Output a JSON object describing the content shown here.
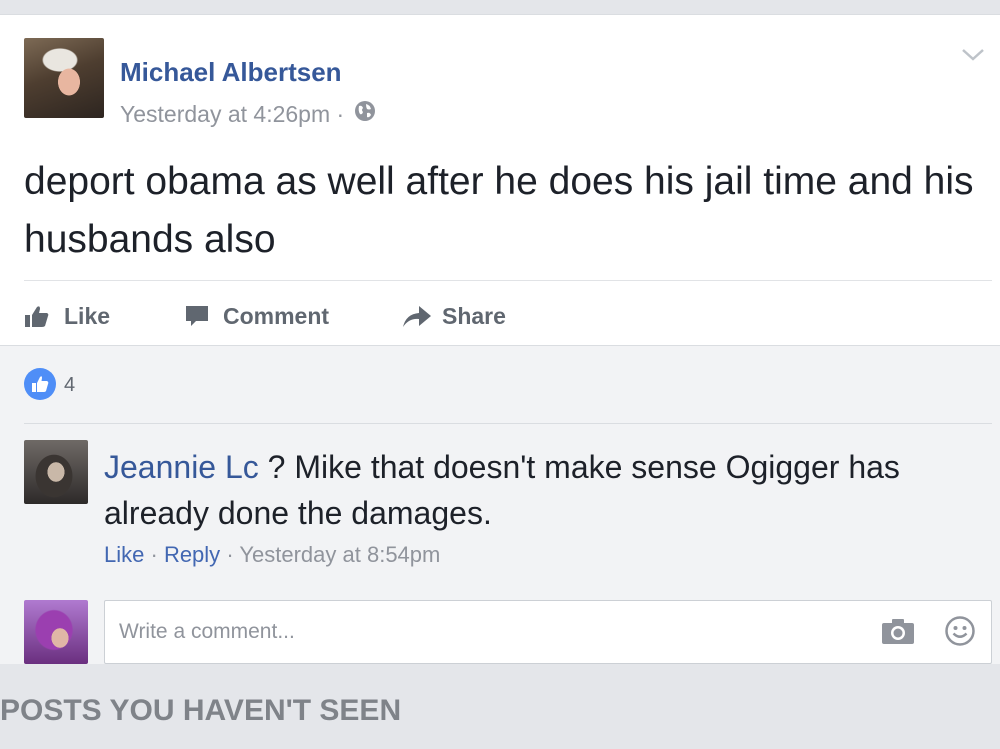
{
  "post": {
    "author": "Michael Albertsen",
    "timestamp": "Yesterday at 4:26pm",
    "separator": "·",
    "privacy_icon": "globe-icon",
    "text": "deport obama as well after he does his jail time and his husbands also",
    "actions": {
      "like_label": "Like",
      "comment_label": "Comment",
      "share_label": "Share"
    },
    "reactions_count": "4"
  },
  "comment": {
    "author": "Jeannie Lc",
    "text": " ? Mike that doesn't make sense Ogigger has already done the damages.",
    "like_label": "Like",
    "reply_label": "Reply",
    "timestamp": "Yesterday at 8:54pm",
    "separator": "·"
  },
  "composer": {
    "placeholder": "Write a comment..."
  },
  "section": {
    "header": "POSTS YOU HAVEN'T SEEN"
  },
  "colors": {
    "link": "#365899",
    "accent": "#4267b2",
    "muted": "#90949c",
    "text": "#1d2129"
  }
}
